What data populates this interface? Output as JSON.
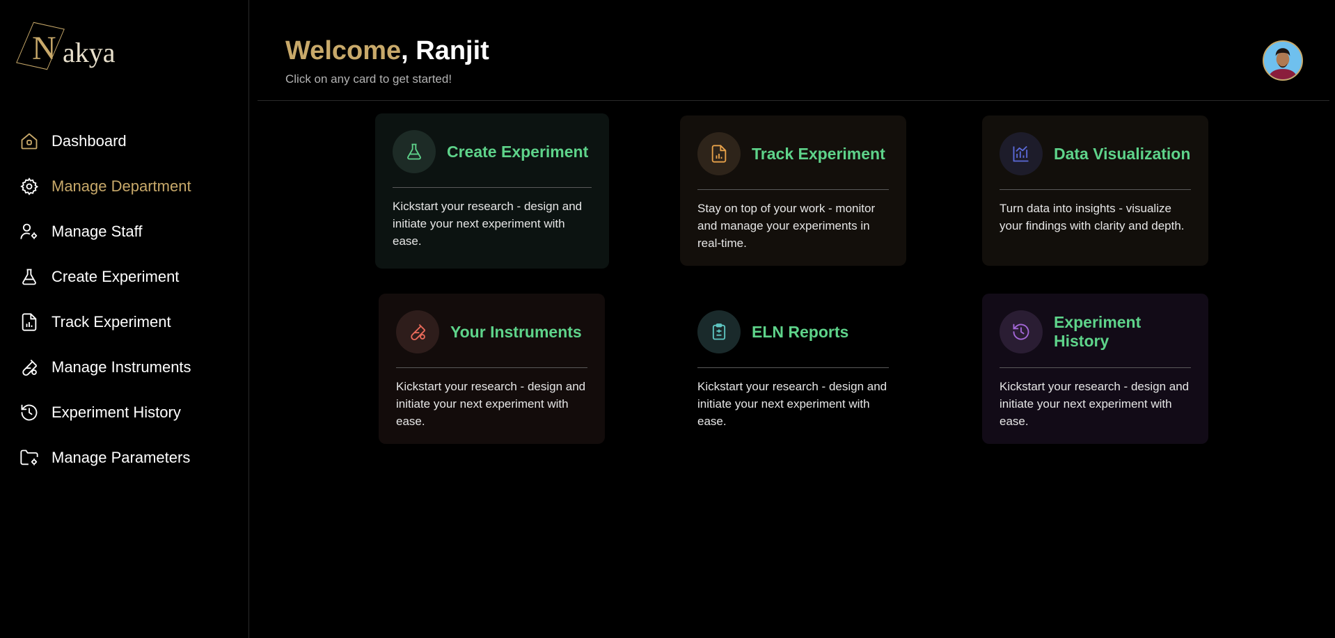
{
  "brand": {
    "logo_initial": "N",
    "logo_rest": "akya"
  },
  "sidebar": {
    "items": [
      {
        "label": "Dashboard",
        "icon": "home-icon"
      },
      {
        "label": "Manage Department",
        "icon": "gear-icon"
      },
      {
        "label": "Manage Staff",
        "icon": "user-gear-icon"
      },
      {
        "label": "Create Experiment",
        "icon": "flask-icon"
      },
      {
        "label": "Track Experiment",
        "icon": "file-chart-icon"
      },
      {
        "label": "Manage Instruments",
        "icon": "test-tube-icon"
      },
      {
        "label": "Experiment History",
        "icon": "history-icon"
      },
      {
        "label": "Manage Parameters",
        "icon": "folder-gear-icon"
      }
    ],
    "active_index": 1
  },
  "header": {
    "welcome": "Welcome",
    "name": ", Ranjit",
    "subtitle": "Click on any card to get started!"
  },
  "cards": [
    {
      "title": "Create Experiment",
      "desc": "Kickstart your research - design and initiate your next experiment with ease.",
      "icon": "flask-icon",
      "accent": "#5ed38a",
      "bg": "#0c1311"
    },
    {
      "title": "Track Experiment",
      "desc": "Stay on top of your work - monitor and manage your experiments in real-time.",
      "icon": "file-chart-icon",
      "accent": "#e8a24a",
      "bg": "#130f0b"
    },
    {
      "title": "Data Visualization",
      "desc": "Turn data into insights - visualize your findings with clarity and depth.",
      "icon": "chart-icon",
      "accent": "#5b6ad8",
      "bg": "#120f0b"
    },
    {
      "title": "Your Instruments",
      "desc": "Kickstart your research - design and initiate your next experiment with ease.",
      "icon": "test-tube-icon",
      "accent": "#e86a5a",
      "bg": "#130c0b"
    },
    {
      "title": "ELN Reports",
      "desc": "Kickstart your research - design and initiate your next experiment with ease.",
      "icon": "clipboard-icon",
      "accent": "#5fc6c2",
      "bg": "#000000"
    },
    {
      "title": "Experiment History",
      "desc": "Kickstart your research - design and initiate your next experiment with ease.",
      "icon": "history-icon",
      "accent": "#a468d8",
      "bg": "#120b17"
    }
  ],
  "colors": {
    "gold": "#c8a96a",
    "green": "#5ed38a"
  }
}
